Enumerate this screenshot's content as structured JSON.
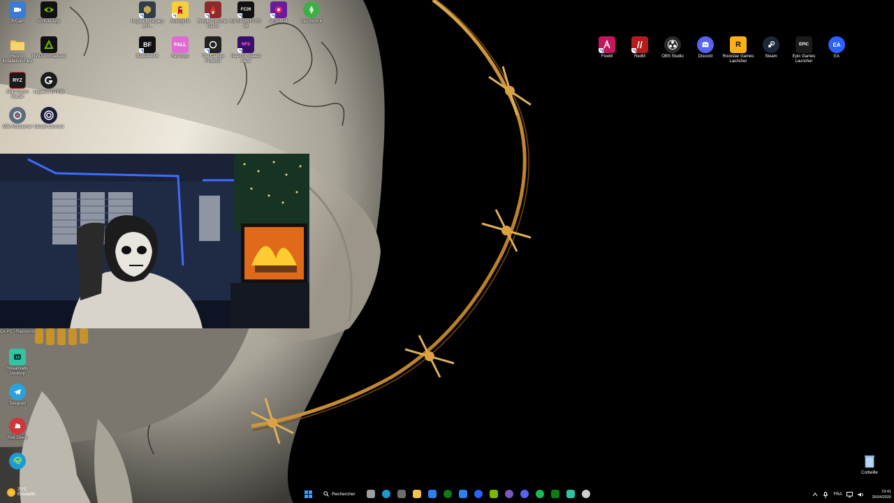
{
  "desktop": {
    "icons_left": [
      {
        "label": "JVCam",
        "icon": "camera-app-icon",
        "color": "#3a7bd5"
      },
      {
        "label": "NVIDIA App",
        "icon": "nvidia-icon",
        "color": "#76b900"
      },
      {
        "label": "Horizon Installation Files",
        "icon": "folder-icon",
        "color": "#f2c14e"
      },
      {
        "label": "NVIDIA Broadcast",
        "icon": "nvidia-broadcast-icon",
        "color": "#76b900"
      },
      {
        "label": "AMD Ryzen Master",
        "icon": "amd-ryzen-icon",
        "color": "#c62828"
      },
      {
        "label": "Logitech G HUB",
        "icon": "logitech-icon",
        "color": "#1c1c1c"
      },
      {
        "label": "MSI Afterburner",
        "icon": "msi-afterburner-icon",
        "color": "#5d6d7e"
      },
      {
        "label": "Ubisoft Connect",
        "icon": "ubisoft-icon",
        "color": "#2c2c7a"
      },
      {
        "label": "Ce PC - Raccourci",
        "icon": "this-pc-icon",
        "color": "#5aa9e6"
      },
      {
        "label": "Streamlabs Desktop",
        "icon": "streamlabs-icon",
        "color": "#31c3a2"
      },
      {
        "label": "Telegram",
        "icon": "telegram-icon",
        "color": "#2aa3dd"
      },
      {
        "label": "Riot Client",
        "icon": "riot-icon",
        "color": "#d13639"
      },
      {
        "label": "Edge",
        "icon": "edge-icon",
        "color": "#1d9bd1"
      }
    ],
    "icons_top": [
      {
        "label": "Hogwarts Legacy L.H...",
        "icon": "hogwarts-icon",
        "color": "#2d3e4a"
      },
      {
        "label": "Among Us",
        "icon": "among-us-icon",
        "color": "#c51111"
      },
      {
        "label": "Burglin' Gnomes Demo",
        "icon": "burglin-gnomes-icon",
        "color": "#8b2b2b"
      },
      {
        "label": "EA SPORTS FC 26",
        "icon": "fc26-icon",
        "color": "#111"
      },
      {
        "label": "eFootball",
        "icon": "efootball-icon",
        "color": "#6a1b9a"
      },
      {
        "label": "Les Sims 4",
        "icon": "sims-icon",
        "color": "#3fae49"
      },
      {
        "label": "Battlefield 6",
        "icon": "battlefield-icon",
        "color": "#111"
      },
      {
        "label": "Fall Guys",
        "icon": "fall-guys-icon",
        "color": "#e06cd1"
      },
      {
        "label": "The Callisto Protocol",
        "icon": "callisto-icon",
        "color": "#222"
      },
      {
        "label": "Need for Speed Heat",
        "icon": "nfs-icon",
        "color": "#3a0f6b"
      }
    ],
    "icons_right": [
      {
        "label": "FiveM",
        "icon": "fivem-icon",
        "color": "#c2185b"
      },
      {
        "label": "RedM",
        "icon": "redm-icon",
        "color": "#b71c1c"
      },
      {
        "label": "OBS Studio",
        "icon": "obs-icon",
        "color": "#2b2b2b"
      },
      {
        "label": "Discord",
        "icon": "discord-icon",
        "color": "#5865f2"
      },
      {
        "label": "Rockstar Games Launcher",
        "icon": "rockstar-icon",
        "color": "#fcaf17"
      },
      {
        "label": "Steam",
        "icon": "steam-icon",
        "color": "#1b2838"
      },
      {
        "label": "Epic Games Launcher",
        "icon": "epic-icon",
        "color": "#1b1b1b"
      },
      {
        "label": "EA",
        "icon": "ea-icon",
        "color": "#2962ff"
      }
    ],
    "recycle_bin": {
      "label": "Corbeille",
      "icon": "recycle-bin-icon"
    }
  },
  "taskbar": {
    "weather": {
      "temp": "21°C",
      "condition": "Ensoleillé"
    },
    "search_label": "Rechercher",
    "pinned": [
      {
        "icon": "task-view-icon",
        "color": "#9e9e9e"
      },
      {
        "icon": "edge-icon",
        "color": "#1d9bd1"
      },
      {
        "icon": "copilot-icon",
        "color": "#6d6d6d"
      },
      {
        "icon": "file-explorer-icon",
        "color": "#f2c14e"
      },
      {
        "icon": "calendar-icon",
        "color": "#2f80ed"
      },
      {
        "icon": "xbox-icon",
        "color": "#107c10"
      },
      {
        "icon": "mail-icon",
        "color": "#2f80ed"
      },
      {
        "icon": "ea-icon",
        "color": "#2962ff"
      },
      {
        "icon": "nvidia-icon",
        "color": "#76b900"
      },
      {
        "icon": "obs-icon",
        "color": "#7e57c2"
      },
      {
        "icon": "discord-icon",
        "color": "#5865f2"
      },
      {
        "icon": "spotify-icon",
        "color": "#1db954"
      },
      {
        "icon": "xbox-app-icon",
        "color": "#107c10"
      },
      {
        "icon": "streamlabs-icon",
        "color": "#31c3a2"
      },
      {
        "icon": "chatgpt-icon",
        "color": "#cfcfcf"
      }
    ],
    "tray": {
      "language": "FRA",
      "time": "19:41",
      "date": "26/04/2026"
    }
  }
}
